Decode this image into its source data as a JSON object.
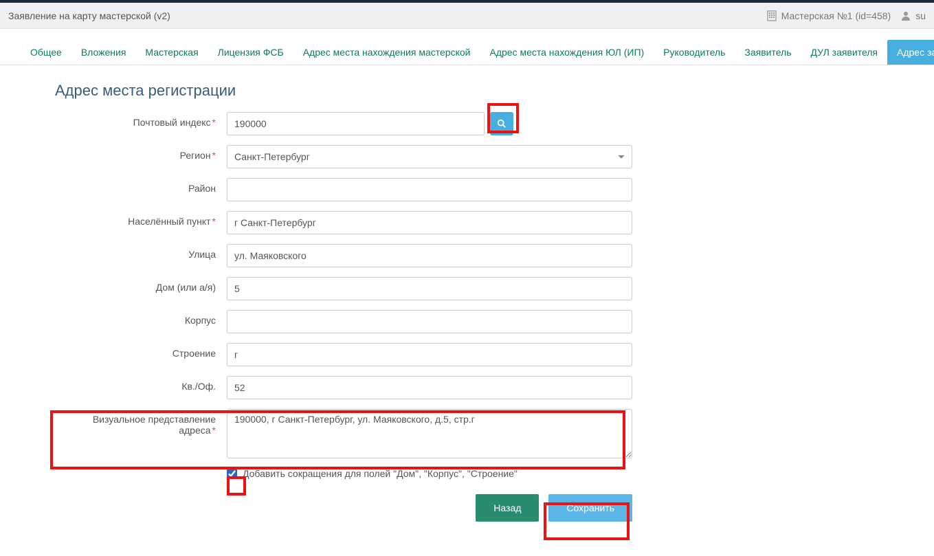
{
  "topbar": {
    "title": "Заявление на карту мастерской (v2)",
    "org": "Мастерская №1 (id=458)",
    "user": "su"
  },
  "tabs": [
    {
      "label": "Общее"
    },
    {
      "label": "Вложения"
    },
    {
      "label": "Мастерская"
    },
    {
      "label": "Лицензия ФСБ"
    },
    {
      "label": "Адрес места нахождения мастерской"
    },
    {
      "label": "Адрес места нахождения ЮЛ (ИП)"
    },
    {
      "label": "Руководитель"
    },
    {
      "label": "Заявитель"
    },
    {
      "label": "ДУЛ заявителя"
    },
    {
      "label": "Адрес заявителя",
      "active": true
    }
  ],
  "section_title": "Адрес места регистрации",
  "labels": {
    "zip": "Почтовый индекс",
    "region": "Регион",
    "district": "Район",
    "city": "Населённый пункт",
    "street": "Улица",
    "house": "Дом (или а/я)",
    "korpus": "Корпус",
    "building": "Строение",
    "flat": "Кв./Оф.",
    "visual": "Визуальное представление адреса",
    "abbr": "Добавить сокращения для полей \"Дом\", \"Корпус\", \"Строение\""
  },
  "values": {
    "zip": "190000",
    "region": "Санкт-Петербург",
    "district": "",
    "city": "г Санкт-Петербург",
    "street": "ул. Маяковского",
    "house": "5",
    "korpus": "",
    "building": "г",
    "flat": "52",
    "visual": "190000, г Санкт-Петербург, ул. Маяковского, д.5, стр.г",
    "abbr_checked": true
  },
  "buttons": {
    "back": "Назад",
    "save": "Сохранить"
  }
}
